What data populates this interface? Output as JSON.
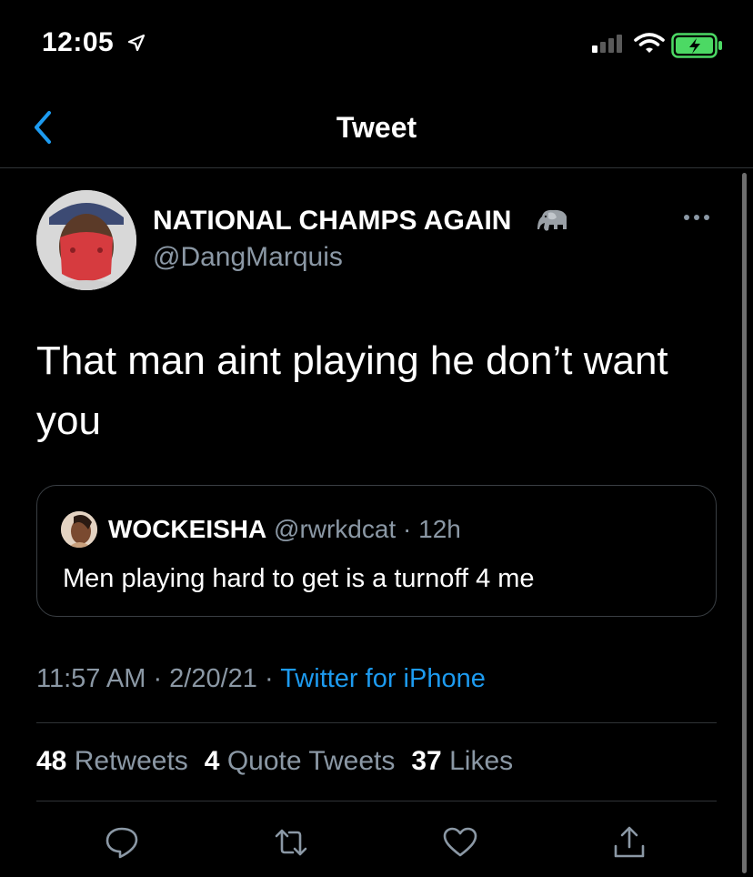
{
  "status_bar": {
    "time": "12:05",
    "icons": [
      "location-arrow-icon",
      "cellular-signal-icon",
      "wifi-icon",
      "battery-charging-icon"
    ]
  },
  "nav": {
    "title": "Tweet",
    "back_icon": "chevron-left-icon"
  },
  "tweet": {
    "author_name": "NATIONAL CHAMPS AGAIN",
    "author_emoji": "elephant-icon",
    "author_handle": "@DangMarquis",
    "text": "That man aint playing he don’t want you",
    "quote": {
      "name": "WOCKEISHA",
      "handle": "@rwrkdcat",
      "separator": "·",
      "age": "12h",
      "text": "Men playing hard to get is a turnoff 4 me"
    },
    "time": "11:57 AM",
    "sep1": " · ",
    "date": "2/20/21",
    "sep2": " · ",
    "source": "Twitter for iPhone"
  },
  "stats": {
    "retweets_count": "48",
    "retweets_label": "Retweets",
    "quotes_count": "4",
    "quotes_label": "Quote Tweets",
    "likes_count": "37",
    "likes_label": "Likes"
  },
  "actions": [
    "reply-icon",
    "retweet-icon",
    "like-icon",
    "share-icon"
  ],
  "colors": {
    "background": "#000000",
    "text": "#ffffff",
    "secondary_text": "#8b98a5",
    "link": "#1d9bf0",
    "nav_accent": "#1d9bf0",
    "divider": "#2f3336",
    "battery": "#4cd964"
  }
}
